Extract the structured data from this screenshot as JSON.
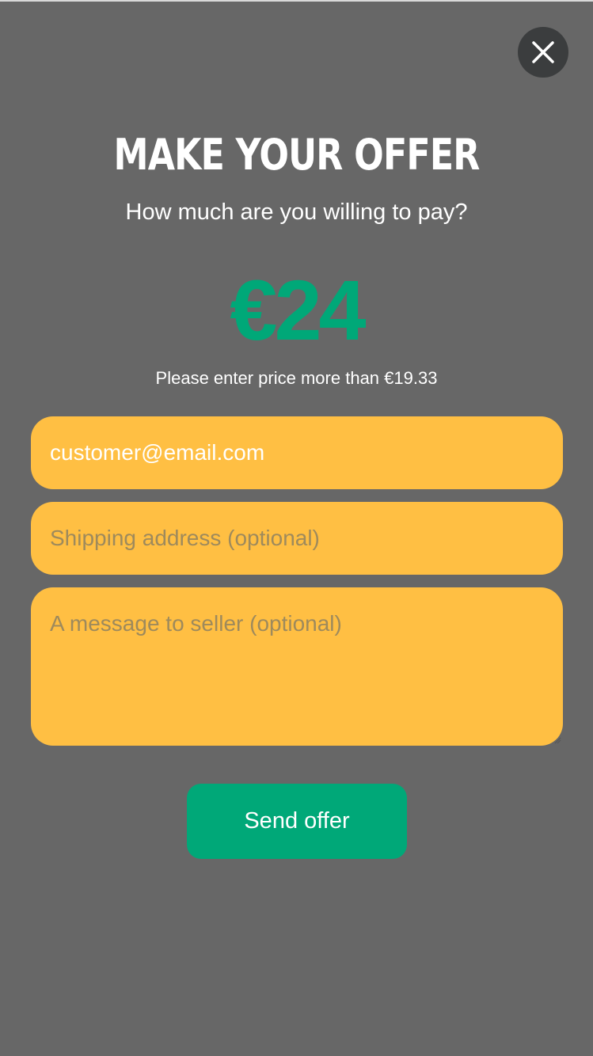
{
  "modal": {
    "title": "MAKE YOUR OFFER",
    "subtitle": "How much are you willing to pay?",
    "close_icon": "close-icon"
  },
  "offer": {
    "amount_display": "€24",
    "hint": "Please enter price more than €19.33"
  },
  "form": {
    "email_value": "customer@email.com",
    "shipping_placeholder": "Shipping address (optional)",
    "message_placeholder": "A message to seller (optional)",
    "send_label": "Send offer"
  },
  "colors": {
    "overlay": "#676767",
    "accent_green": "#00a878",
    "field_yellow": "#ffbf43",
    "close_button": "#3b3d3e"
  }
}
